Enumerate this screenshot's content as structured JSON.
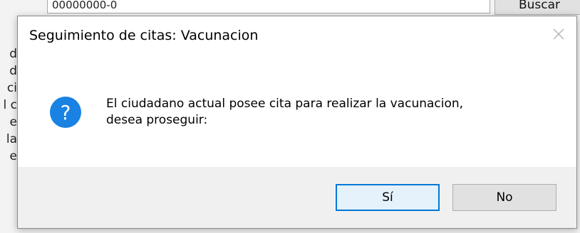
{
  "background": {
    "field_value": "00000000-0",
    "search_button_label": "Buscar",
    "side_fragments": [
      "d",
      "d",
      "ci",
      "l c",
      "e c",
      "la",
      "e v"
    ]
  },
  "dialog": {
    "title": "Seguimiento de citas: Vacunacion",
    "close_icon": "close-icon",
    "icon": "question-icon",
    "message_line1": "El ciudadano actual posee cita para realizar la vacunacion,",
    "message_line2": "desea proseguir:",
    "buttons": {
      "yes_label": "Sí",
      "no_label": "No"
    }
  },
  "colors": {
    "accent": "#0078d7",
    "icon_blue": "#1a82e2"
  }
}
